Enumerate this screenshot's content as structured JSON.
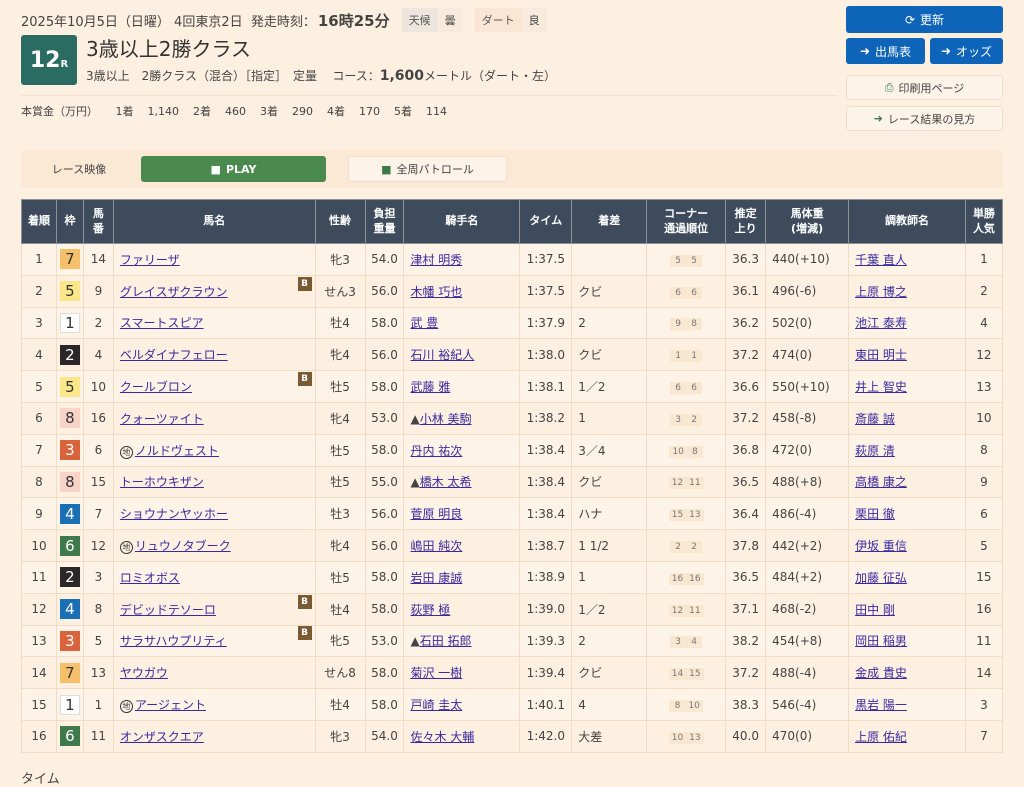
{
  "header": {
    "date": "2025年10月5日（日曜）",
    "meeting": "4回東京2日",
    "start_label": "発走時刻：",
    "start_time": "16時25分",
    "weather_label": "天候",
    "weather": "曇",
    "surface_label": "ダート",
    "going": "良",
    "race_no": "12",
    "race_suffix": "R",
    "title": "3歳以上2勝クラス",
    "conditions": "3歳以上　2勝クラス（混合）［指定］　定量",
    "course_label": "コース：",
    "distance": "1,600",
    "course_unit": "メートル（ダート・左）"
  },
  "prize": {
    "label": "本賞金（万円）",
    "items": [
      [
        "1着",
        "1,140"
      ],
      [
        "2着",
        "460"
      ],
      [
        "3着",
        "290"
      ],
      [
        "4着",
        "170"
      ],
      [
        "5着",
        "114"
      ]
    ]
  },
  "buttons": {
    "refresh": "更新",
    "entries": "出馬表",
    "odds": "オッズ",
    "print": "印刷用ページ",
    "howto": "レース結果の見方"
  },
  "video": {
    "label": "レース映像",
    "play": "PLAY",
    "patrol": "全周パトロール"
  },
  "columns": [
    "着順",
    "枠",
    "馬番",
    "馬名",
    "性齢",
    "負担重量",
    "騎手名",
    "タイム",
    "着差",
    "コーナー通過順位",
    "推定上り",
    "馬体重(増減)",
    "調教師名",
    "単勝人気"
  ],
  "waku_colors": {
    "1": "#ffffff",
    "2": "#2b2628",
    "3": "#d9633a",
    "4": "#1a6fb5",
    "5": "#fbe68a",
    "6": "#3f7a4a",
    "7": "#f6c06a",
    "8": "#f8d3c8"
  },
  "rows": [
    {
      "pos": "1",
      "waku": "7",
      "num": "14",
      "horse": "ファリーザ",
      "blinker": false,
      "local": false,
      "sexage": "牝3",
      "wt": "54.0",
      "jockey": "津村 明秀",
      "mark": "",
      "time": "1:37.5",
      "margin": "",
      "corner": [
        "5",
        "5"
      ],
      "last3f": "36.3",
      "body": "440(+10)",
      "trainer": "千葉 直人",
      "pop": "1"
    },
    {
      "pos": "2",
      "waku": "5",
      "num": "9",
      "horse": "グレイスザクラウン",
      "blinker": true,
      "local": false,
      "sexage": "せん3",
      "wt": "56.0",
      "jockey": "木幡 巧也",
      "mark": "",
      "time": "1:37.5",
      "margin": "クビ",
      "corner": [
        "6",
        "6"
      ],
      "last3f": "36.1",
      "body": "496(-6)",
      "trainer": "上原 博之",
      "pop": "2"
    },
    {
      "pos": "3",
      "waku": "1",
      "num": "2",
      "horse": "スマートスピア",
      "blinker": false,
      "local": false,
      "sexage": "牡4",
      "wt": "58.0",
      "jockey": "武 豊",
      "mark": "",
      "time": "1:37.9",
      "margin": "2",
      "corner": [
        "9",
        "8"
      ],
      "last3f": "36.2",
      "body": "502(0)",
      "trainer": "池江 泰寿",
      "pop": "4"
    },
    {
      "pos": "4",
      "waku": "2",
      "num": "4",
      "horse": "ベルダイナフェロー",
      "blinker": false,
      "local": false,
      "sexage": "牝4",
      "wt": "56.0",
      "jockey": "石川 裕紀人",
      "mark": "",
      "time": "1:38.0",
      "margin": "クビ",
      "corner": [
        "1",
        "1"
      ],
      "last3f": "37.2",
      "body": "474(0)",
      "trainer": "東田 明士",
      "pop": "12"
    },
    {
      "pos": "5",
      "waku": "5",
      "num": "10",
      "horse": "クールブロン",
      "blinker": true,
      "local": false,
      "sexage": "牡5",
      "wt": "58.0",
      "jockey": "武藤 雅",
      "mark": "",
      "time": "1:38.1",
      "margin": "1／2",
      "corner": [
        "6",
        "6"
      ],
      "last3f": "36.6",
      "body": "550(+10)",
      "trainer": "井上 智史",
      "pop": "13"
    },
    {
      "pos": "6",
      "waku": "8",
      "num": "16",
      "horse": "クォーツァイト",
      "blinker": false,
      "local": false,
      "sexage": "牝4",
      "wt": "53.0",
      "jockey": "小林 美駒",
      "mark": "▲",
      "time": "1:38.2",
      "margin": "1",
      "corner": [
        "3",
        "2"
      ],
      "last3f": "37.2",
      "body": "458(-8)",
      "trainer": "斎藤 誠",
      "pop": "10"
    },
    {
      "pos": "7",
      "waku": "3",
      "num": "6",
      "horse": "ノルドヴェスト",
      "blinker": false,
      "local": true,
      "sexage": "牡5",
      "wt": "58.0",
      "jockey": "丹内 祐次",
      "mark": "",
      "time": "1:38.4",
      "margin": "3／4",
      "corner": [
        "10",
        "8"
      ],
      "last3f": "36.8",
      "body": "472(0)",
      "trainer": "萩原 清",
      "pop": "8"
    },
    {
      "pos": "8",
      "waku": "8",
      "num": "15",
      "horse": "トーホウキザン",
      "blinker": false,
      "local": false,
      "sexage": "牡5",
      "wt": "55.0",
      "jockey": "橋木 太希",
      "mark": "▲",
      "time": "1:38.4",
      "margin": "クビ",
      "corner": [
        "12",
        "11"
      ],
      "last3f": "36.5",
      "body": "488(+8)",
      "trainer": "高橋 康之",
      "pop": "9"
    },
    {
      "pos": "9",
      "waku": "4",
      "num": "7",
      "horse": "ショウナンヤッホー",
      "blinker": false,
      "local": false,
      "sexage": "牡3",
      "wt": "56.0",
      "jockey": "菅原 明良",
      "mark": "",
      "time": "1:38.4",
      "margin": "ハナ",
      "corner": [
        "15",
        "13"
      ],
      "last3f": "36.4",
      "body": "486(-4)",
      "trainer": "栗田 徹",
      "pop": "6"
    },
    {
      "pos": "10",
      "waku": "6",
      "num": "12",
      "horse": "リュウノタブーク",
      "blinker": false,
      "local": true,
      "sexage": "牝4",
      "wt": "56.0",
      "jockey": "嶋田 純次",
      "mark": "",
      "time": "1:38.7",
      "margin": "1 1/2",
      "corner": [
        "2",
        "2"
      ],
      "last3f": "37.8",
      "body": "442(+2)",
      "trainer": "伊坂 重信",
      "pop": "5"
    },
    {
      "pos": "11",
      "waku": "2",
      "num": "3",
      "horse": "ロミオボス",
      "blinker": false,
      "local": false,
      "sexage": "牡5",
      "wt": "58.0",
      "jockey": "岩田 康誠",
      "mark": "",
      "time": "1:38.9",
      "margin": "1",
      "corner": [
        "16",
        "16"
      ],
      "last3f": "36.5",
      "body": "484(+2)",
      "trainer": "加藤 征弘",
      "pop": "15"
    },
    {
      "pos": "12",
      "waku": "4",
      "num": "8",
      "horse": "デビッドテソーロ",
      "blinker": true,
      "local": false,
      "sexage": "牡4",
      "wt": "58.0",
      "jockey": "荻野 極",
      "mark": "",
      "time": "1:39.0",
      "margin": "1／2",
      "corner": [
        "12",
        "11"
      ],
      "last3f": "37.1",
      "body": "468(-2)",
      "trainer": "田中 剛",
      "pop": "16"
    },
    {
      "pos": "13",
      "waku": "3",
      "num": "5",
      "horse": "サラサハウプリティ",
      "blinker": true,
      "local": false,
      "sexage": "牝5",
      "wt": "53.0",
      "jockey": "石田 拓郎",
      "mark": "▲",
      "time": "1:39.3",
      "margin": "2",
      "corner": [
        "3",
        "4"
      ],
      "last3f": "38.2",
      "body": "454(+8)",
      "trainer": "岡田 稲男",
      "pop": "11"
    },
    {
      "pos": "14",
      "waku": "7",
      "num": "13",
      "horse": "ヤウガウ",
      "blinker": false,
      "local": false,
      "sexage": "せん8",
      "wt": "58.0",
      "jockey": "菊沢 一樹",
      "mark": "",
      "time": "1:39.4",
      "margin": "クビ",
      "corner": [
        "14",
        "15"
      ],
      "last3f": "37.2",
      "body": "488(-4)",
      "trainer": "金成 貴史",
      "pop": "14"
    },
    {
      "pos": "15",
      "waku": "1",
      "num": "1",
      "horse": "アージェント",
      "blinker": false,
      "local": true,
      "sexage": "牡4",
      "wt": "58.0",
      "jockey": "戸崎 圭太",
      "mark": "",
      "time": "1:40.1",
      "margin": "4",
      "corner": [
        "8",
        "10"
      ],
      "last3f": "38.3",
      "body": "546(-4)",
      "trainer": "黒岩 陽一",
      "pop": "3"
    },
    {
      "pos": "16",
      "waku": "6",
      "num": "11",
      "horse": "オンザスクエア",
      "blinker": false,
      "local": false,
      "sexage": "牝3",
      "wt": "54.0",
      "jockey": "佐々木 大輔",
      "mark": "",
      "time": "1:42.0",
      "margin": "大差",
      "corner": [
        "10",
        "13"
      ],
      "last3f": "40.0",
      "body": "470(0)",
      "trainer": "上原 佑紀",
      "pop": "7"
    }
  ],
  "blinker_label": "B",
  "local_label": "地",
  "section_time": "タイム"
}
